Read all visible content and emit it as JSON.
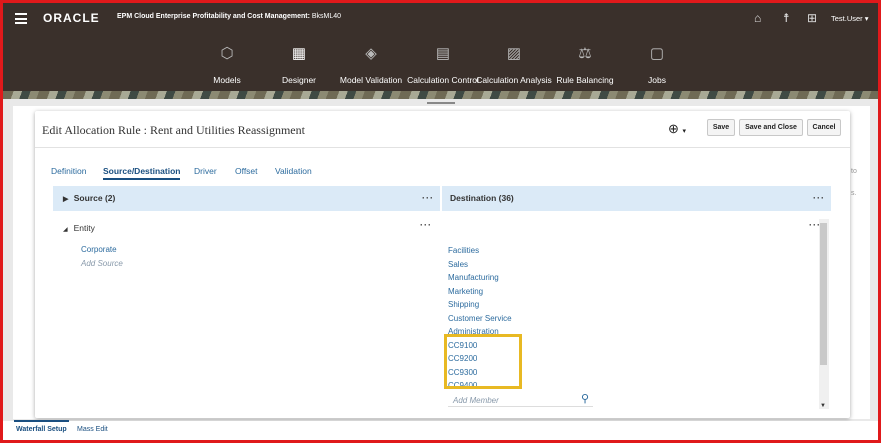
{
  "header": {
    "brand": "ORACLE",
    "app_title_bold": "EPM Cloud Enterprise Profitability and Cost Management:",
    "app_name": "BksML40",
    "user": "Test.User ▾",
    "nav": [
      {
        "label": "Models",
        "icon": "models-icon"
      },
      {
        "label": "Designer",
        "icon": "designer-icon"
      },
      {
        "label": "Model Validation",
        "icon": "model-validation-icon"
      },
      {
        "label": "Calculation Control",
        "icon": "calculation-control-icon"
      },
      {
        "label": "Calculation Analysis",
        "icon": "calculation-analysis-icon"
      },
      {
        "label": "Rule Balancing",
        "icon": "rule-balancing-icon"
      },
      {
        "label": "Jobs",
        "icon": "jobs-icon"
      }
    ]
  },
  "dialog": {
    "title": "Edit Allocation Rule : Rent and Utilities Reassignment",
    "buttons": {
      "save": "Save",
      "save_close": "Save and Close",
      "cancel": "Cancel"
    },
    "tabs": [
      "Definition",
      "Source/Destination",
      "Driver",
      "Offset",
      "Validation"
    ],
    "active_tab": "Source/Destination",
    "source": {
      "header": "Source (2)",
      "dimension": "Entity",
      "members": [
        "Corporate"
      ],
      "add_placeholder": "Add Source"
    },
    "destination": {
      "header": "Destination (36)",
      "members": [
        "Facilities",
        "Sales",
        "Manufacturing",
        "Marketing",
        "Shipping",
        "Customer Service",
        "Administration",
        "CC9100",
        "CC9200",
        "CC9300",
        "CC9400"
      ],
      "add_placeholder": "Add Member"
    },
    "more_glyph": "···"
  },
  "background_page": {
    "fragments": [
      "to",
      "s."
    ]
  },
  "bottom_tabs": [
    "Waterfall Setup",
    "Mass Edit"
  ],
  "colors": {
    "header_bg": "#3a302b",
    "link": "#2c6b9e",
    "column_header_bg": "#dbeaf7",
    "highlight": "#e8b923",
    "frame": "#e0191b"
  }
}
